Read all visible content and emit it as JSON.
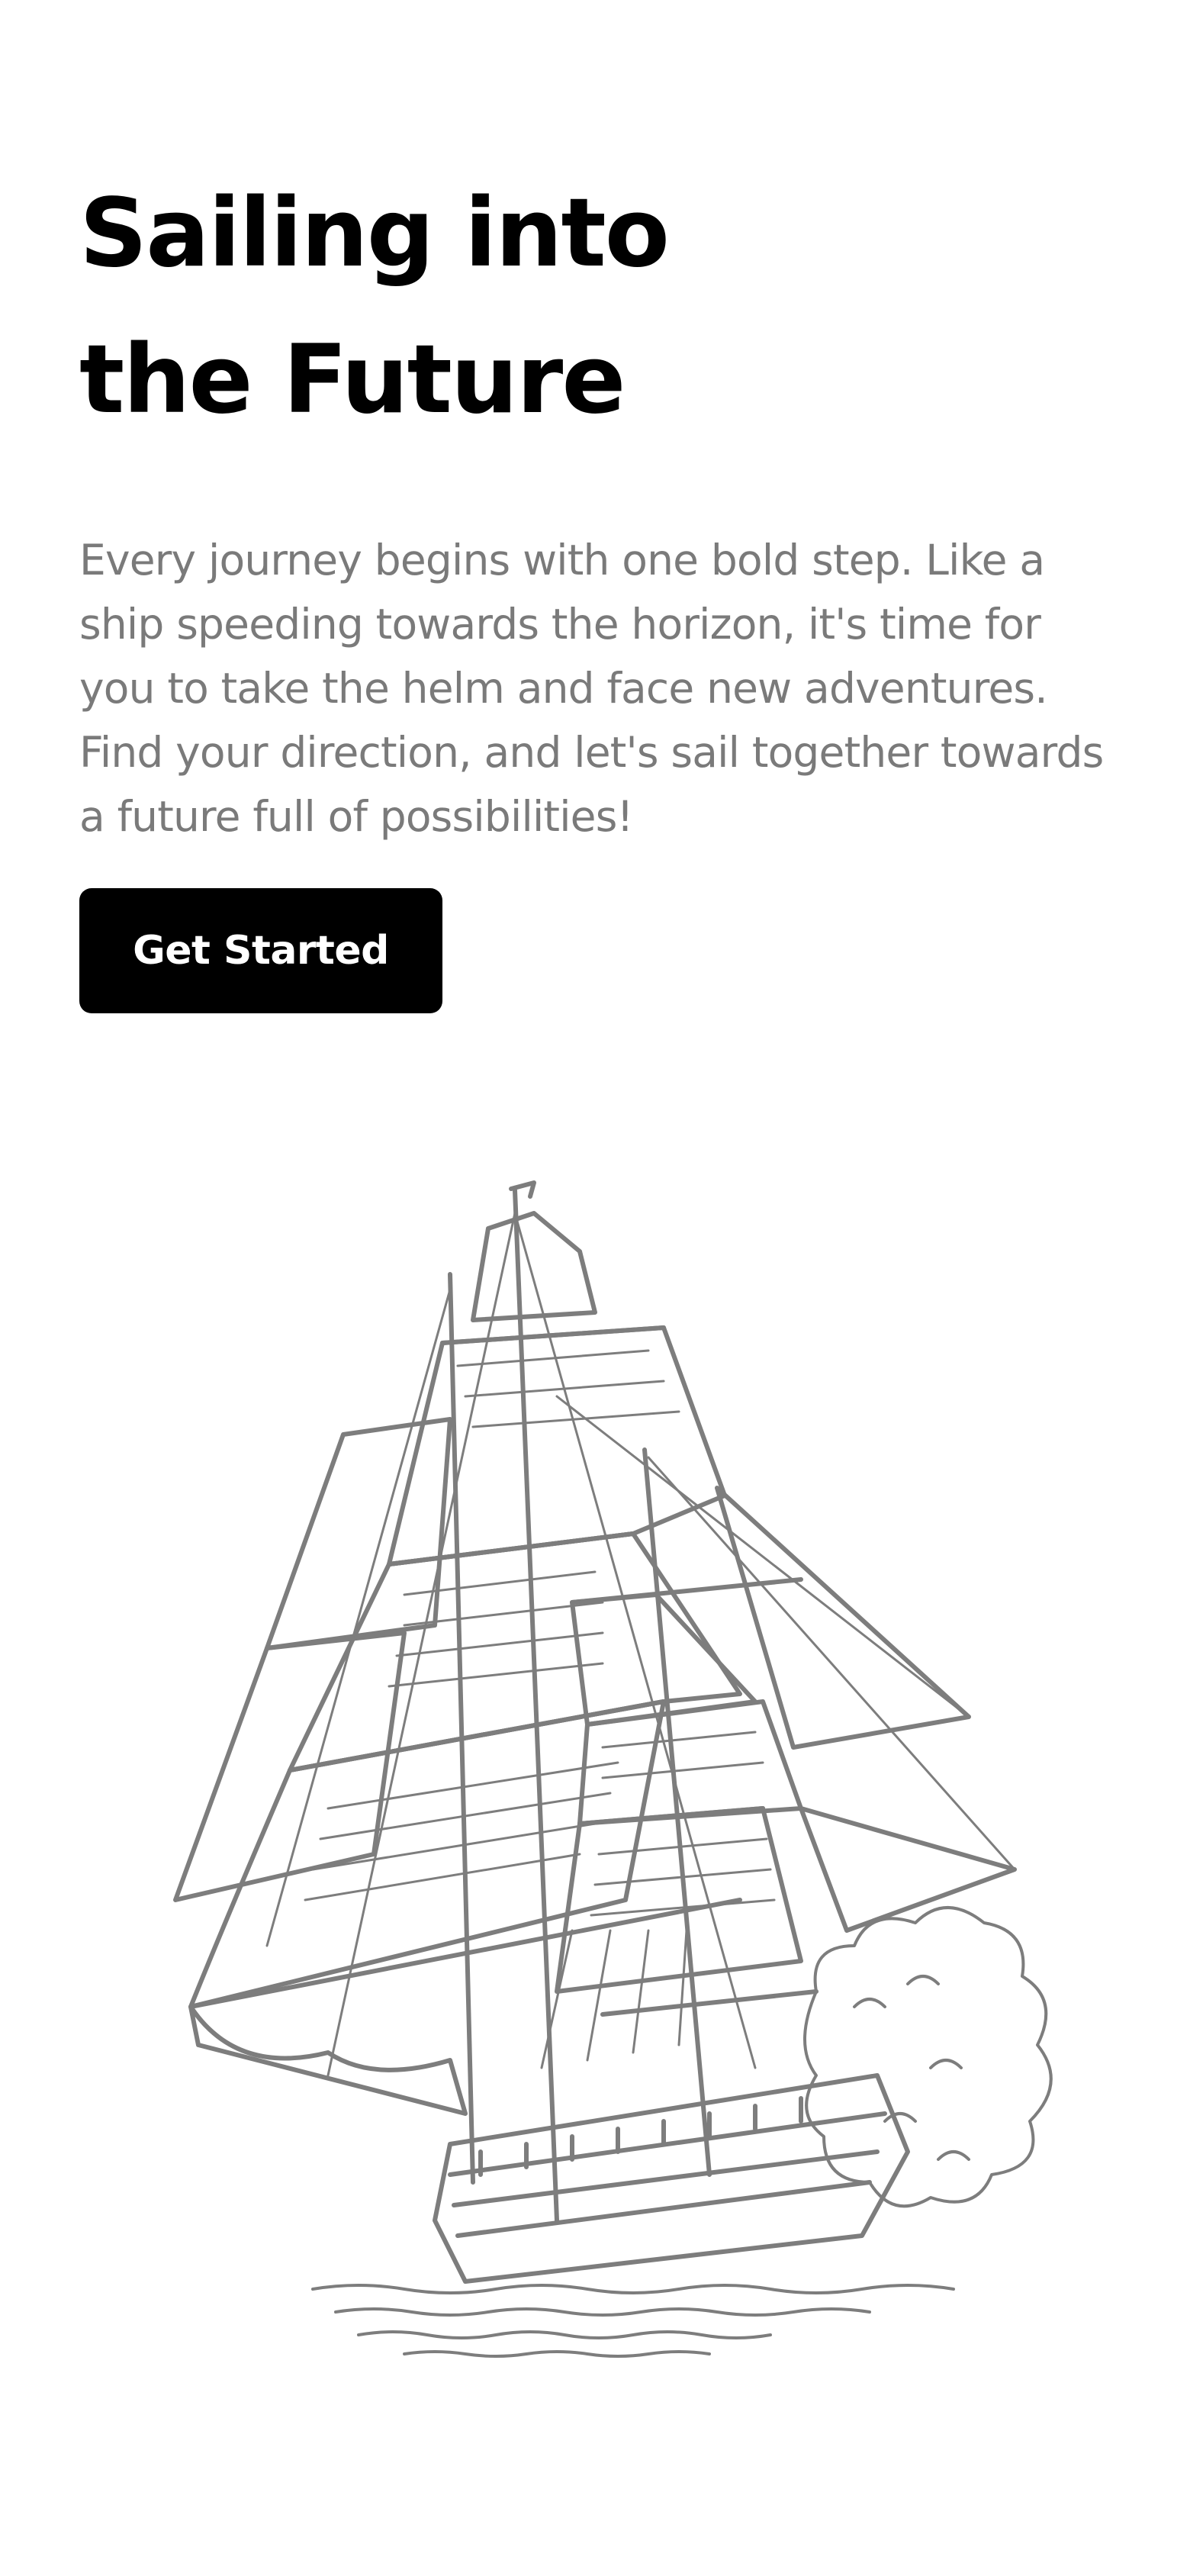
{
  "hero": {
    "title_line_1": "Sailing into",
    "title_line_2": "the Future",
    "body": "Every journey begins with one bold step. Like a ship speeding towards the horizon, it's time for you to take the helm and face new adventures. Find your direction, and let's sail together towards a future full of possibilities!",
    "cta_label": "Get Started"
  },
  "illustration": {
    "subject": "sailing-ship-sketch",
    "stroke_color": "#7d7d7d"
  },
  "colors": {
    "background": "#ffffff",
    "title": "#000000",
    "body_text": "#7a7a7a",
    "button_bg": "#000000",
    "button_text": "#ffffff"
  }
}
